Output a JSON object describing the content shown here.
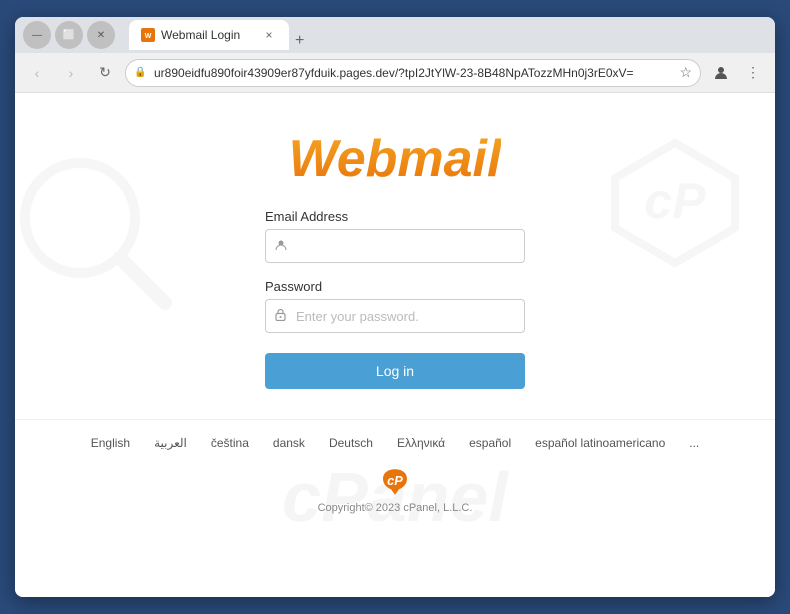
{
  "browser": {
    "tab_favicon": "W",
    "tab_title": "Webmail Login",
    "tab_close": "×",
    "new_tab": "+",
    "back_btn": "‹",
    "forward_btn": "›",
    "refresh_btn": "↻",
    "address": "ur890eidfu890foir43909er87yfduik.pages.dev/?tpI2JtYlW-23-8B48NpATozzMHn0j3rE0xV=",
    "star_icon": "☆",
    "profile_icon": "👤",
    "menu_icon": "⋮"
  },
  "page": {
    "logo": "Webmail",
    "form": {
      "email_label": "Email Address",
      "email_placeholder": "",
      "password_label": "Password",
      "password_placeholder": "Enter your password.",
      "login_button": "Log in"
    },
    "languages": [
      "English",
      "العربية",
      "čeština",
      "dansk",
      "Deutsch",
      "Ελληνικά",
      "español",
      "español latinoamericano",
      "..."
    ],
    "footer_copyright": "Copyright© 2023 cPanel, L.L.C."
  }
}
